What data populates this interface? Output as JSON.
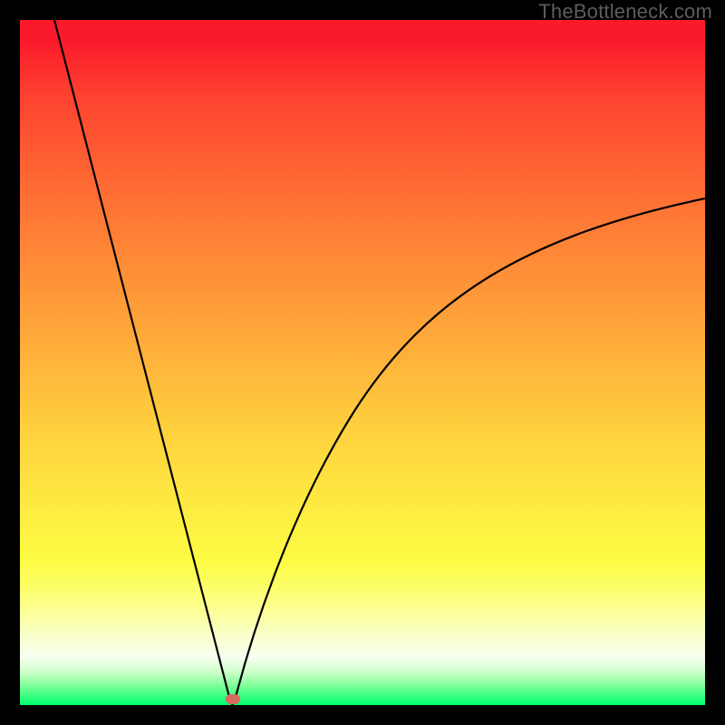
{
  "watermark": "TheBottleneck.com",
  "colors": {
    "frame": "#000000",
    "curve": "#000000",
    "marker": "#d86a5f",
    "gradient_top": "#fb1a2b",
    "gradient_bottom": "#00ff6e"
  },
  "chart_data": {
    "type": "line",
    "title": "",
    "xlabel": "",
    "ylabel": "",
    "xlim": [
      0,
      100
    ],
    "ylim": [
      0,
      100
    ],
    "description": "Bottleneck / deviation curve with a single sharp minimum. Background is a vertical red-to-green gradient (red=high bottleneck, green=optimal). Curve drops steeply from top-left to a cusp near x≈31 at y≈0, then rises concavely toward the right edge at y≈74.",
    "series": [
      {
        "name": "bottleneck-curve",
        "x": [
          5,
          8,
          11,
          14,
          17,
          20,
          23,
          26,
          29,
          30.7,
          31,
          31.3,
          33,
          36,
          40,
          45,
          50,
          55,
          60,
          65,
          70,
          75,
          80,
          85,
          90,
          95,
          100
        ],
        "y": [
          100,
          88.5,
          77,
          65.4,
          53.8,
          42.3,
          30.8,
          19.2,
          7.7,
          1.5,
          0.4,
          1.4,
          7.0,
          15.5,
          24.8,
          33.9,
          41.1,
          47.0,
          51.9,
          56.0,
          59.5,
          62.5,
          65.1,
          67.4,
          69.5,
          71.8,
          74.0
        ]
      }
    ],
    "marker": {
      "x": 31,
      "y": 0.4,
      "label": "optimal-point"
    }
  }
}
